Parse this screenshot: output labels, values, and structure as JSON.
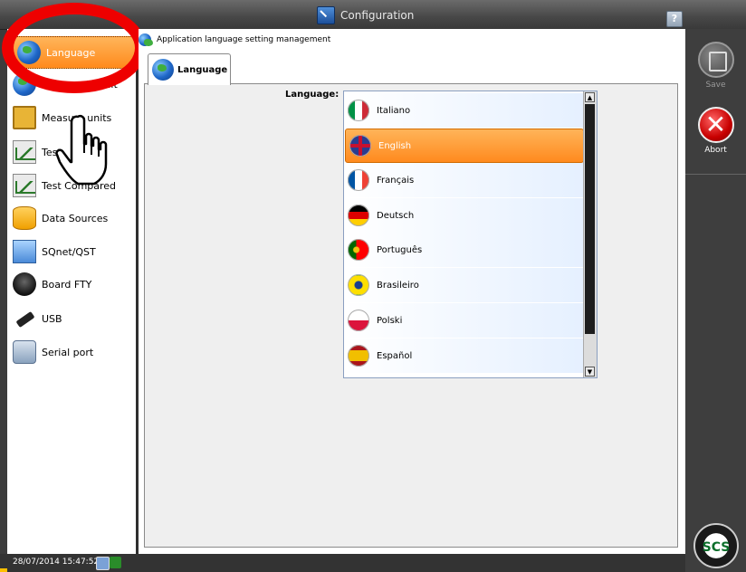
{
  "window": {
    "title": "Configuration",
    "help_icon": "help-icon"
  },
  "sidebar": {
    "items": [
      {
        "label": "Language",
        "icon": "globe-icon",
        "active": true
      },
      {
        "label": "Feature default",
        "icon": "globe-icon"
      },
      {
        "label": "Measure units",
        "icon": "ruler-icon"
      },
      {
        "label": "Test",
        "icon": "chart-icon"
      },
      {
        "label": "Test Compared",
        "icon": "chart-compare-icon"
      },
      {
        "label": "Data Sources",
        "icon": "database-icon"
      },
      {
        "label": "SQnet/QST",
        "icon": "wave-icon"
      },
      {
        "label": "Board FTY",
        "icon": "board-icon"
      },
      {
        "label": "USB",
        "icon": "usb-icon"
      },
      {
        "label": "Serial port",
        "icon": "serial-icon"
      }
    ]
  },
  "main": {
    "header": "Application language setting management",
    "tab_label": "Language",
    "field_label": "Language:",
    "languages": [
      {
        "label": "Italiano",
        "flag": "flag-italy-icon"
      },
      {
        "label": "English",
        "flag": "flag-uk-icon",
        "selected": true
      },
      {
        "label": "Français",
        "flag": "flag-france-icon"
      },
      {
        "label": "Deutsch",
        "flag": "flag-germany-icon"
      },
      {
        "label": "Português",
        "flag": "flag-portugal-icon"
      },
      {
        "label": "Brasileiro",
        "flag": "flag-brazil-icon"
      },
      {
        "label": "Polski",
        "flag": "flag-poland-icon"
      },
      {
        "label": "Español",
        "flag": "flag-spain-icon"
      }
    ]
  },
  "actions": {
    "save_label": "Save",
    "abort_label": "Abort"
  },
  "status": {
    "datetime": "28/07/2014 15:47:52"
  },
  "colors": {
    "accent": "#ff8a1c",
    "save_label": "#9a9a9a",
    "abort_label": "#ffffff",
    "highlight_ring": "#ee0000"
  },
  "logo_text": "SCS"
}
